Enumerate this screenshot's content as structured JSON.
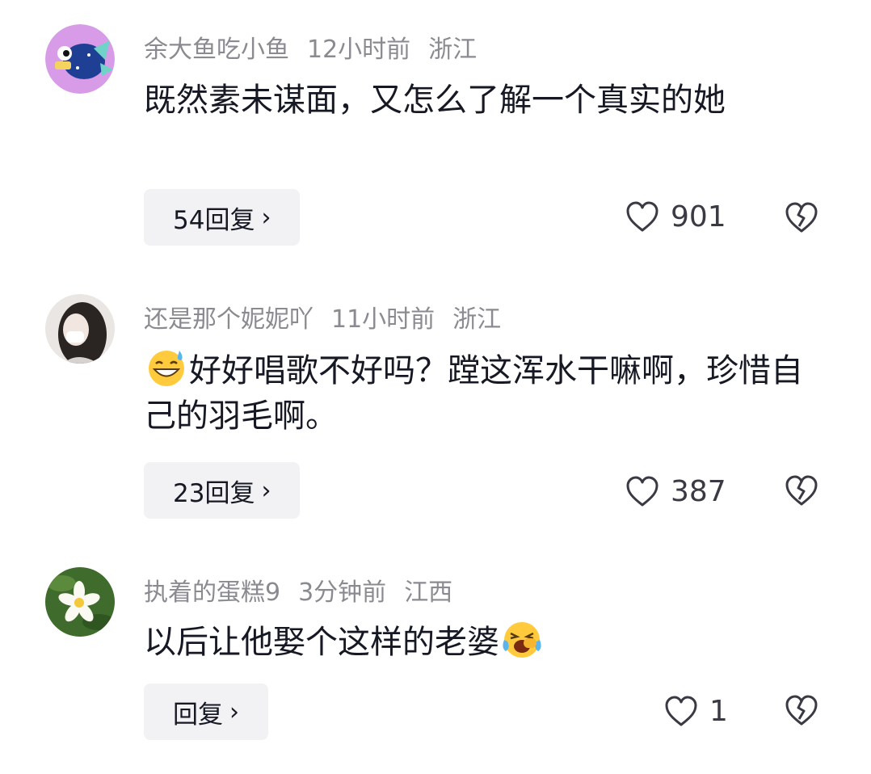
{
  "comments": [
    {
      "username": "余大鱼吃小鱼",
      "time": "12小时前",
      "location": "浙江",
      "text": "既然素未谋面，又怎么了解一个真实的她",
      "reply_label": "54回复",
      "likes": "901",
      "avatar_icon": "fish-avatar"
    },
    {
      "username": "还是那个妮妮吖",
      "time": "11小时前",
      "location": "浙江",
      "text": "好好唱歌不好吗？蹚这浑水干嘛啊，珍惜自己的羽毛啊。",
      "reply_label": "23回复",
      "likes": "387",
      "avatar_icon": "girl-avatar",
      "emoji": "grinning-sweat-emoji"
    },
    {
      "username": "执着的蛋糕9",
      "time": "3分钟前",
      "location": "江西",
      "text": "以后让他娶个这样的老婆",
      "reply_label": "回复",
      "likes": "1",
      "avatar_icon": "flower-avatar",
      "emoji": "laughing-crying-emoji"
    }
  ],
  "colors": {
    "meta": "#8a8b91",
    "text": "#161823",
    "button_bg": "#f2f2f4"
  }
}
